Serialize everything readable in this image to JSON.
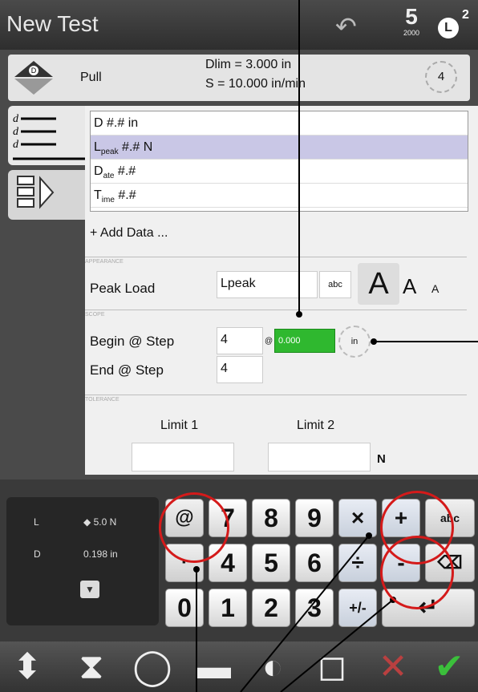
{
  "app": {
    "title": "New Test"
  },
  "header": {
    "step_count": "5",
    "step_sub": "2000",
    "profile_letter": "L",
    "profile_sup": "2"
  },
  "pull": {
    "label": "Pull",
    "dlim": "Dlim = 3.000 in",
    "speed": "S = 10.000 in/min",
    "step_number": "4"
  },
  "data_list": {
    "items": [
      {
        "prefix": "D",
        "sub": "",
        "value": " #.# in"
      },
      {
        "prefix": "L",
        "sub": "peak",
        "value": " #.# N"
      },
      {
        "prefix": "D",
        "sub": "ate",
        "value": " #.#"
      },
      {
        "prefix": "T",
        "sub": "ime",
        "value": " #.#"
      }
    ],
    "add_label": "+ Add Data ..."
  },
  "appearance": {
    "section": "APPEARANCE",
    "label": "Peak Load",
    "value": "Lpeak",
    "abc": "abc",
    "font_l": "A",
    "font_m": "A",
    "font_s": "A"
  },
  "scope": {
    "section": "SCOPE",
    "begin_label": "Begin @ Step",
    "begin_value": "4",
    "at": "@",
    "distance": "0.000",
    "unit": "in",
    "end_label": "End @ Step",
    "end_value": "4"
  },
  "tolerance": {
    "section": "TOLERANCE",
    "limit1_label": "Limit 1",
    "limit2_label": "Limit 2",
    "unit": "N"
  },
  "readout": {
    "l_label": "L",
    "l_value": "◆ 5.0 N",
    "d_label": "D",
    "d_value": "0.198 in"
  },
  "keypad": {
    "row1": [
      "@",
      "7",
      "8",
      "9",
      "×",
      "+",
      "abc"
    ],
    "row2": [
      "·",
      "4",
      "5",
      "6",
      "÷",
      "-",
      "⌫"
    ],
    "row3": [
      "0",
      "1",
      "2",
      "3",
      "+/-",
      "↵"
    ]
  },
  "toolbar": {
    "icons": [
      "updown-icon",
      "hourglass-icon",
      "cycle-icon",
      "pause-icon",
      "checker-icon",
      "comment-icon",
      "cancel-icon",
      "accept-icon"
    ]
  },
  "colors": {
    "accent_green": "#2fb82f",
    "highlight": "#c9c7e6",
    "annotation_red": "#d41a1a"
  }
}
